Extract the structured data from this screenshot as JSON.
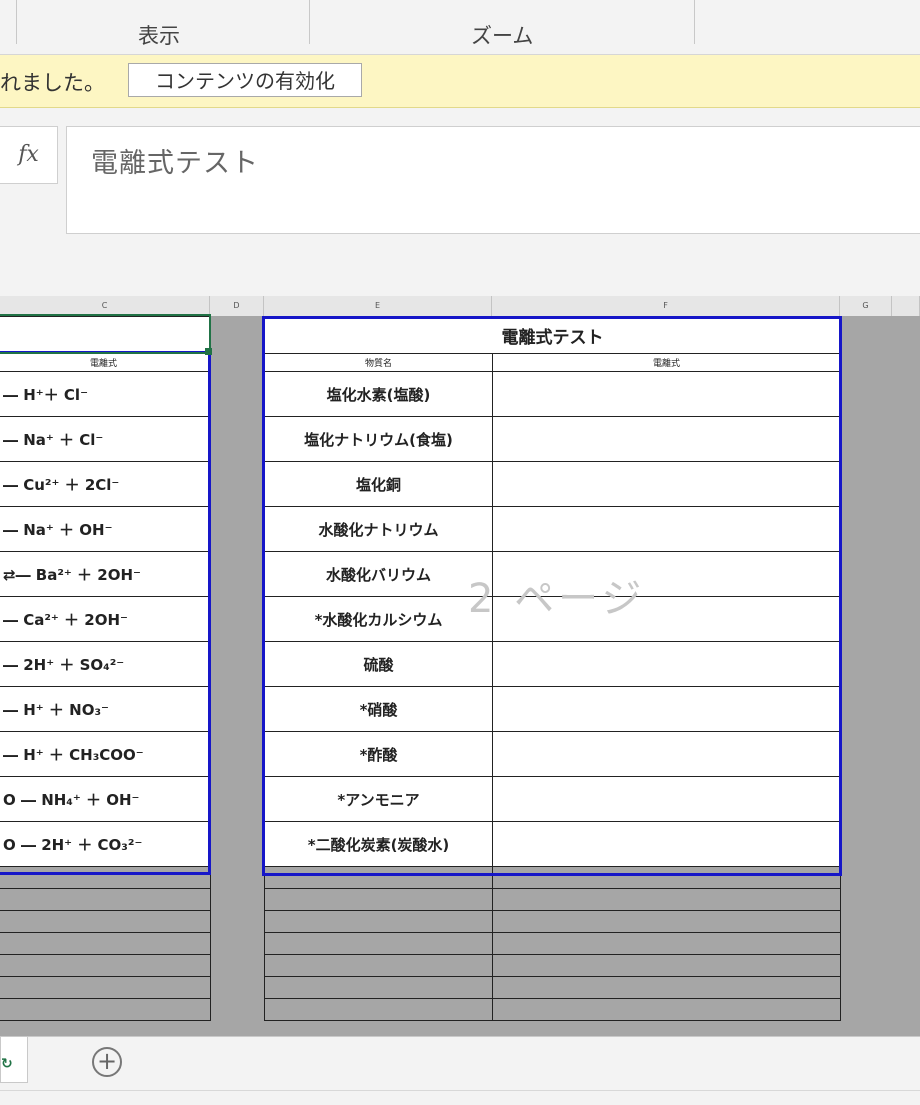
{
  "ribbon": {
    "groups": [
      "表示",
      "ズーム"
    ]
  },
  "message_bar": {
    "text": "れました。",
    "button_label": "コンテンツの有効化"
  },
  "formula_bar": {
    "fx_label": "fx",
    "content": "電離式テスト"
  },
  "columns": [
    "C",
    "D",
    "E",
    "F",
    "G"
  ],
  "left_table": {
    "subheader": "電離式",
    "rows": [
      "― H⁺＋ Cl⁻",
      "― Na⁺ ＋ Cl⁻",
      "― Cu²⁺ ＋ 2Cl⁻",
      "― Na⁺ ＋ OH⁻",
      "⇄― Ba²⁺ ＋ 2OH⁻",
      "― Ca²⁺ ＋ 2OH⁻",
      "― 2H⁺ ＋ SO₄²⁻",
      "― H⁺ ＋ NO₃⁻",
      "― H⁺ ＋ CH₃COO⁻",
      "O ― NH₄⁺ ＋ OH⁻",
      "O ― 2H⁺ ＋ CO₃²⁻"
    ]
  },
  "right_table": {
    "title": "電離式テスト",
    "col_substance": "物質名",
    "col_formula": "電離式",
    "rows": [
      "塩化水素(塩酸)",
      "塩化ナトリウム(食塩)",
      "塩化銅",
      "水酸化ナトリウム",
      "水酸化バリウム",
      "*水酸化カルシウム",
      "硫酸",
      "*硝酸",
      "*酢酸",
      "*アンモニア",
      "*二酸化炭素(炭酸水)"
    ]
  },
  "page_watermark": "2 ページ",
  "sheet_tabs": {
    "add_label": "+"
  }
}
